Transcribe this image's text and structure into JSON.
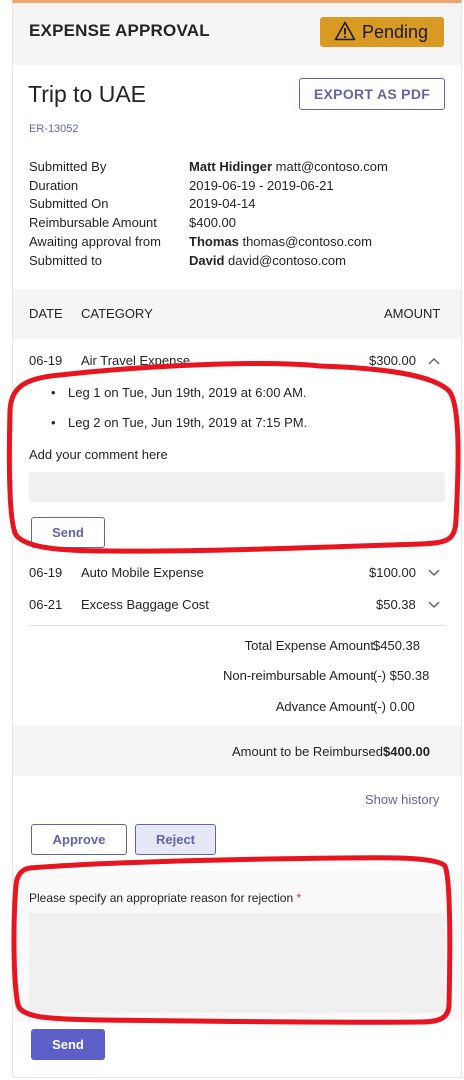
{
  "header": {
    "title": "EXPENSE APPROVAL",
    "status": "Pending",
    "status_icon": "warning-icon",
    "status_color": "#d89a23"
  },
  "report": {
    "title": "Trip to UAE",
    "export_label": "EXPORT AS PDF",
    "id": "ER-13052"
  },
  "details": [
    {
      "label": "Submitted By",
      "bold": "Matt Hidinger",
      "rest": " matt@contoso.com"
    },
    {
      "label": "Duration",
      "bold": "",
      "rest": "2019-06-19 - 2019-06-21"
    },
    {
      "label": "Submitted On",
      "bold": "",
      "rest": "2019-04-14"
    },
    {
      "label": "Reimbursable Amount",
      "bold": "",
      "rest": "$400.00"
    },
    {
      "label": "Awaiting approval from",
      "bold": "Thomas",
      "rest": " thomas@contoso.com"
    },
    {
      "label": "Submitted to",
      "bold": "David",
      "rest": " david@contoso.com"
    }
  ],
  "table": {
    "headers": {
      "date": "DATE",
      "category": "CATEGORY",
      "amount": "AMOUNT"
    },
    "rows": [
      {
        "date": "06-19",
        "category": "Air Travel Expense",
        "amount": "$300.00",
        "expanded": true
      },
      {
        "date": "06-19",
        "category": "Auto Mobile Expense",
        "amount": "$100.00",
        "expanded": false
      },
      {
        "date": "06-21",
        "category": "Excess Baggage Cost",
        "amount": "$50.38",
        "expanded": false
      }
    ]
  },
  "expanded_detail": {
    "bullets": [
      "Leg 1 on Tue, Jun 19th, 2019 at 6:00 AM.",
      "Leg 2 on Tue, Jun 19th, 2019 at 7:15 PM."
    ],
    "comment_label": "Add your comment here",
    "send_label": "Send"
  },
  "totals": [
    {
      "label": "Total Expense Amount",
      "value": "$450.38"
    },
    {
      "label": "Non-reimbursable Amount",
      "value": "(-) $50.38"
    },
    {
      "label": "Advance Amount",
      "value": "(-) 0.00"
    }
  ],
  "reimbursed": {
    "label": "Amount to be Reimbursed",
    "value": "$400.00"
  },
  "actions": {
    "show_history": "Show history",
    "approve": "Approve",
    "reject": "Reject"
  },
  "rejection": {
    "label": "Please specify an appropriate reason for rejection",
    "required_mark": "*",
    "send_label": "Send"
  },
  "colors": {
    "accent": "#6264a7",
    "primary_button": "#5b5fc7",
    "annotation": "#e8141f"
  }
}
